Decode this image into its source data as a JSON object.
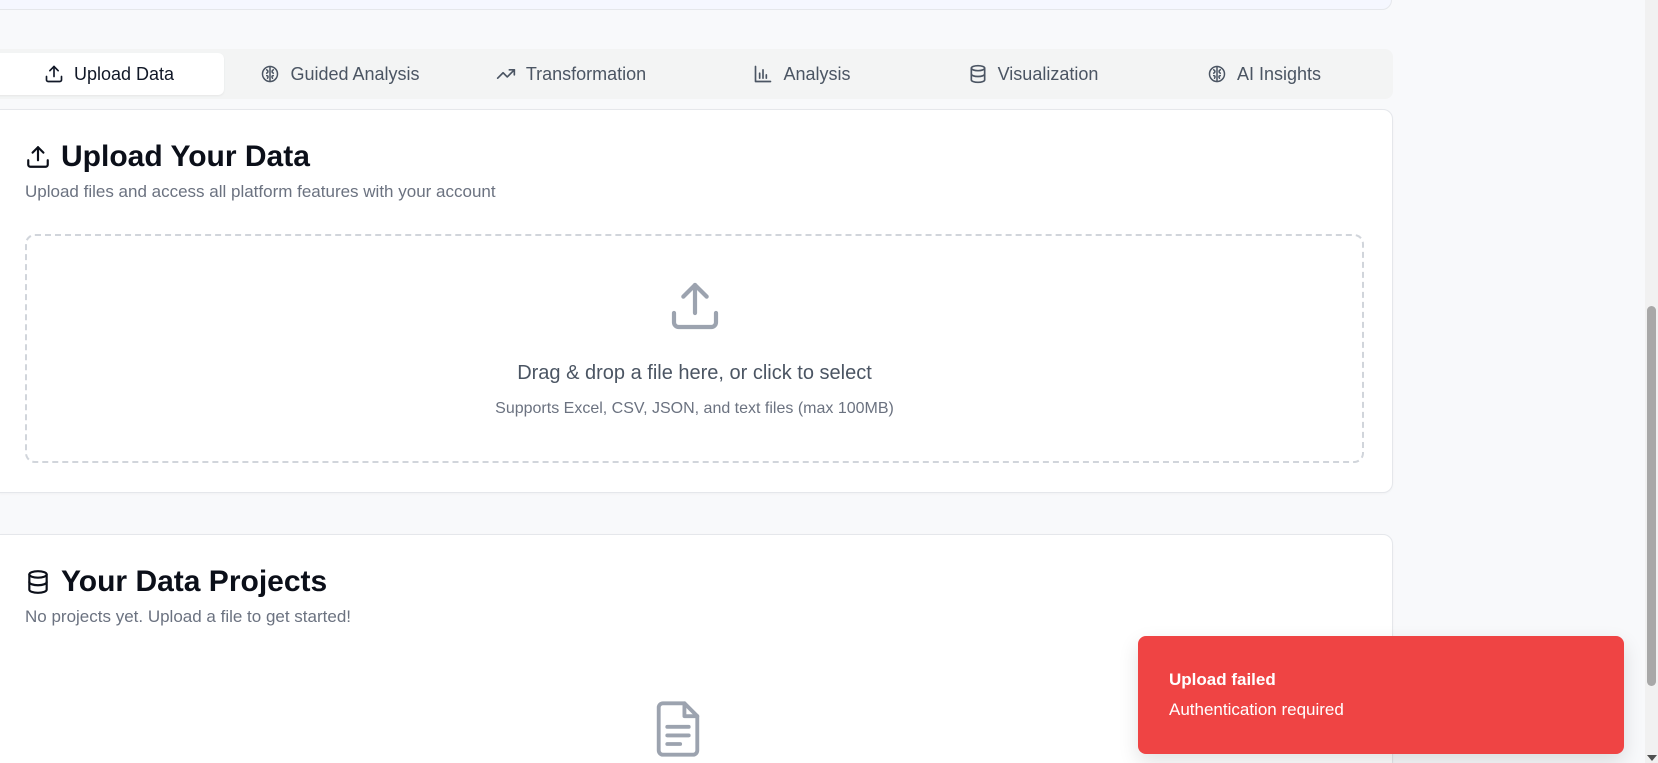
{
  "tabs": [
    {
      "label": "Upload Data",
      "icon": "upload-icon",
      "active": true
    },
    {
      "label": "Guided Analysis",
      "icon": "brain-icon",
      "active": false
    },
    {
      "label": "Transformation",
      "icon": "trending-up-icon",
      "active": false
    },
    {
      "label": "Analysis",
      "icon": "bar-chart-icon",
      "active": false
    },
    {
      "label": "Visualization",
      "icon": "database-icon",
      "active": false
    },
    {
      "label": "AI Insights",
      "icon": "brain-icon",
      "active": false
    }
  ],
  "upload": {
    "title": "Upload Your Data",
    "subtitle": "Upload files and access all platform features with your account",
    "drop_text": "Drag & drop a file here, or click to select",
    "drop_hint": "Supports Excel, CSV, JSON, and text files (max 100MB)"
  },
  "projects": {
    "title": "Your Data Projects",
    "subtitle": "No projects yet. Upload a file to get started!"
  },
  "toast": {
    "title": "Upload failed",
    "description": "Authentication required",
    "color": "#ef4444"
  },
  "colors": {
    "accent_error": "#ef4444",
    "icon_muted": "#9ca3af"
  }
}
